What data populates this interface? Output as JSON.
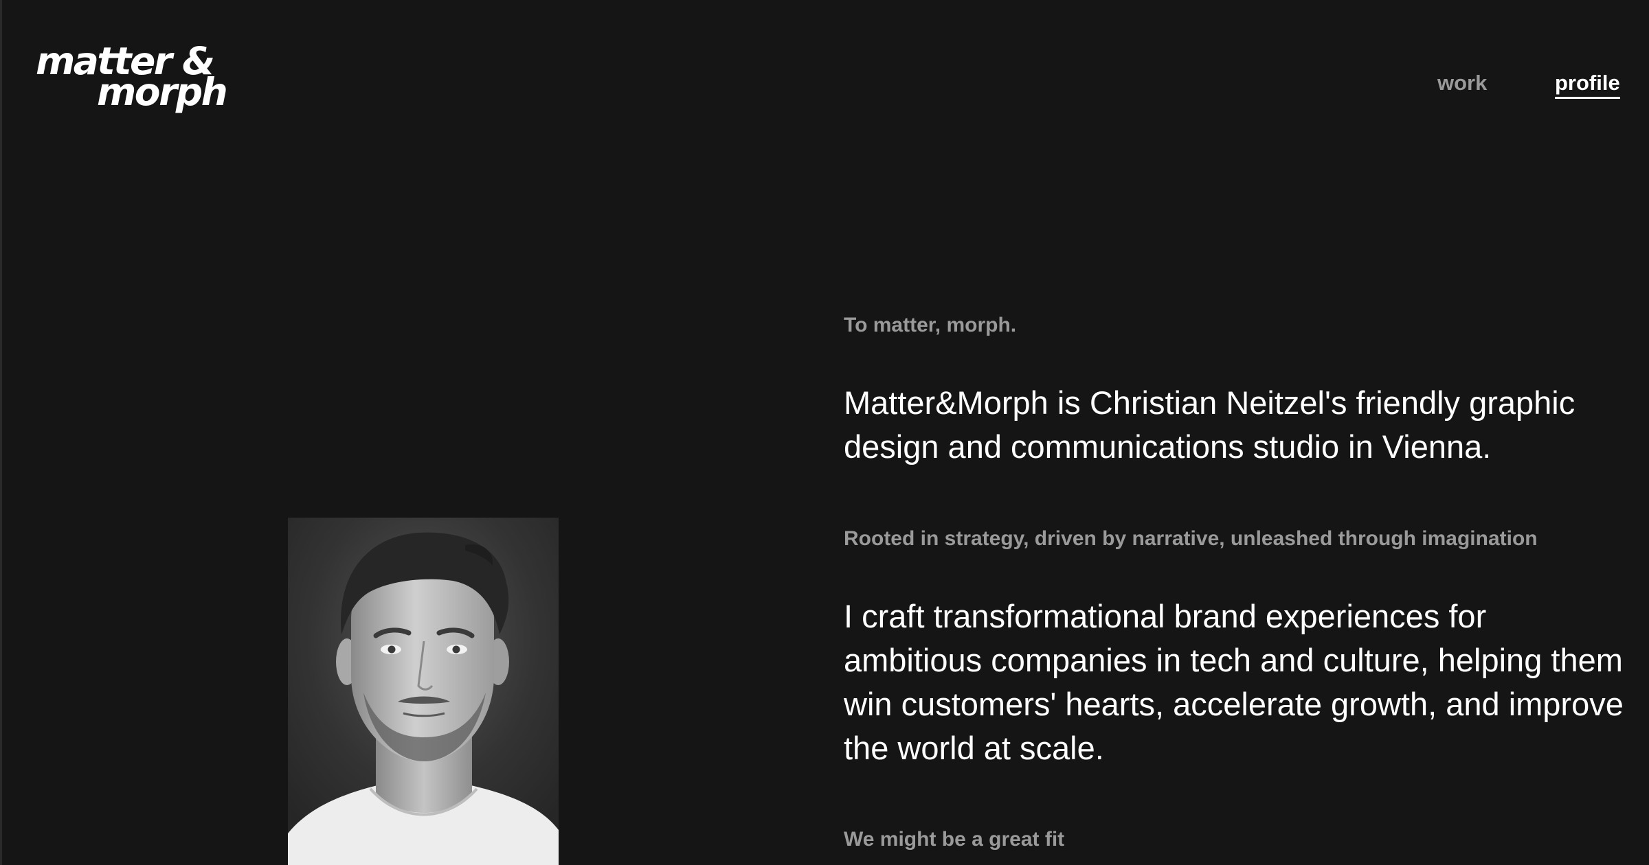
{
  "header": {
    "logo_line1": "matter &",
    "logo_line2": "morph",
    "nav": {
      "work": "work",
      "profile": "profile"
    }
  },
  "main": {
    "tagline": "To matter, morph.",
    "intro": "Matter&Morph is Christian Neitzel's friendly graphic design and communications studio in Vienna.",
    "subheading": "Rooted in strategy, driven by narrative, unleashed through imagination",
    "body": "I craft transformational brand experiences for ambitious companies in tech and culture, helping them win customers' hearts, accelerate growth, and improve the world at scale.",
    "closing": "We might be a great fit"
  },
  "colors": {
    "background": "#151515",
    "primary_text": "#ffffff",
    "muted_text": "#9a9a9a"
  }
}
